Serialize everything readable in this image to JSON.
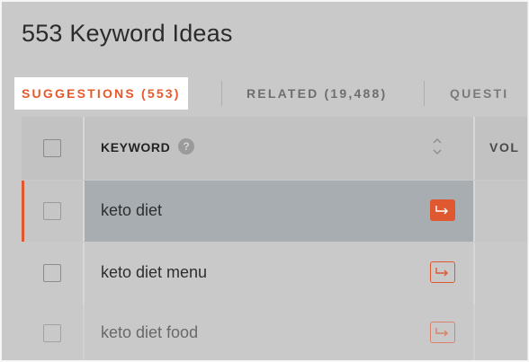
{
  "page": {
    "title": "553 Keyword Ideas"
  },
  "tabs": [
    {
      "label": "SUGGESTIONS (553)",
      "active": true
    },
    {
      "label": "RELATED (19,488)",
      "active": false
    },
    {
      "label": "QUESTI",
      "active": false
    }
  ],
  "table": {
    "columns": {
      "keyword": "KEYWORD",
      "volume": "VOL"
    },
    "help_glyph": "?",
    "rows": [
      {
        "keyword": "keto diet",
        "selected": true
      },
      {
        "keyword": "keto diet menu",
        "selected": false
      },
      {
        "keyword": "keto diet food",
        "selected": false
      }
    ]
  },
  "colors": {
    "accent": "#e0582f",
    "tab_active": "#e8582b"
  }
}
